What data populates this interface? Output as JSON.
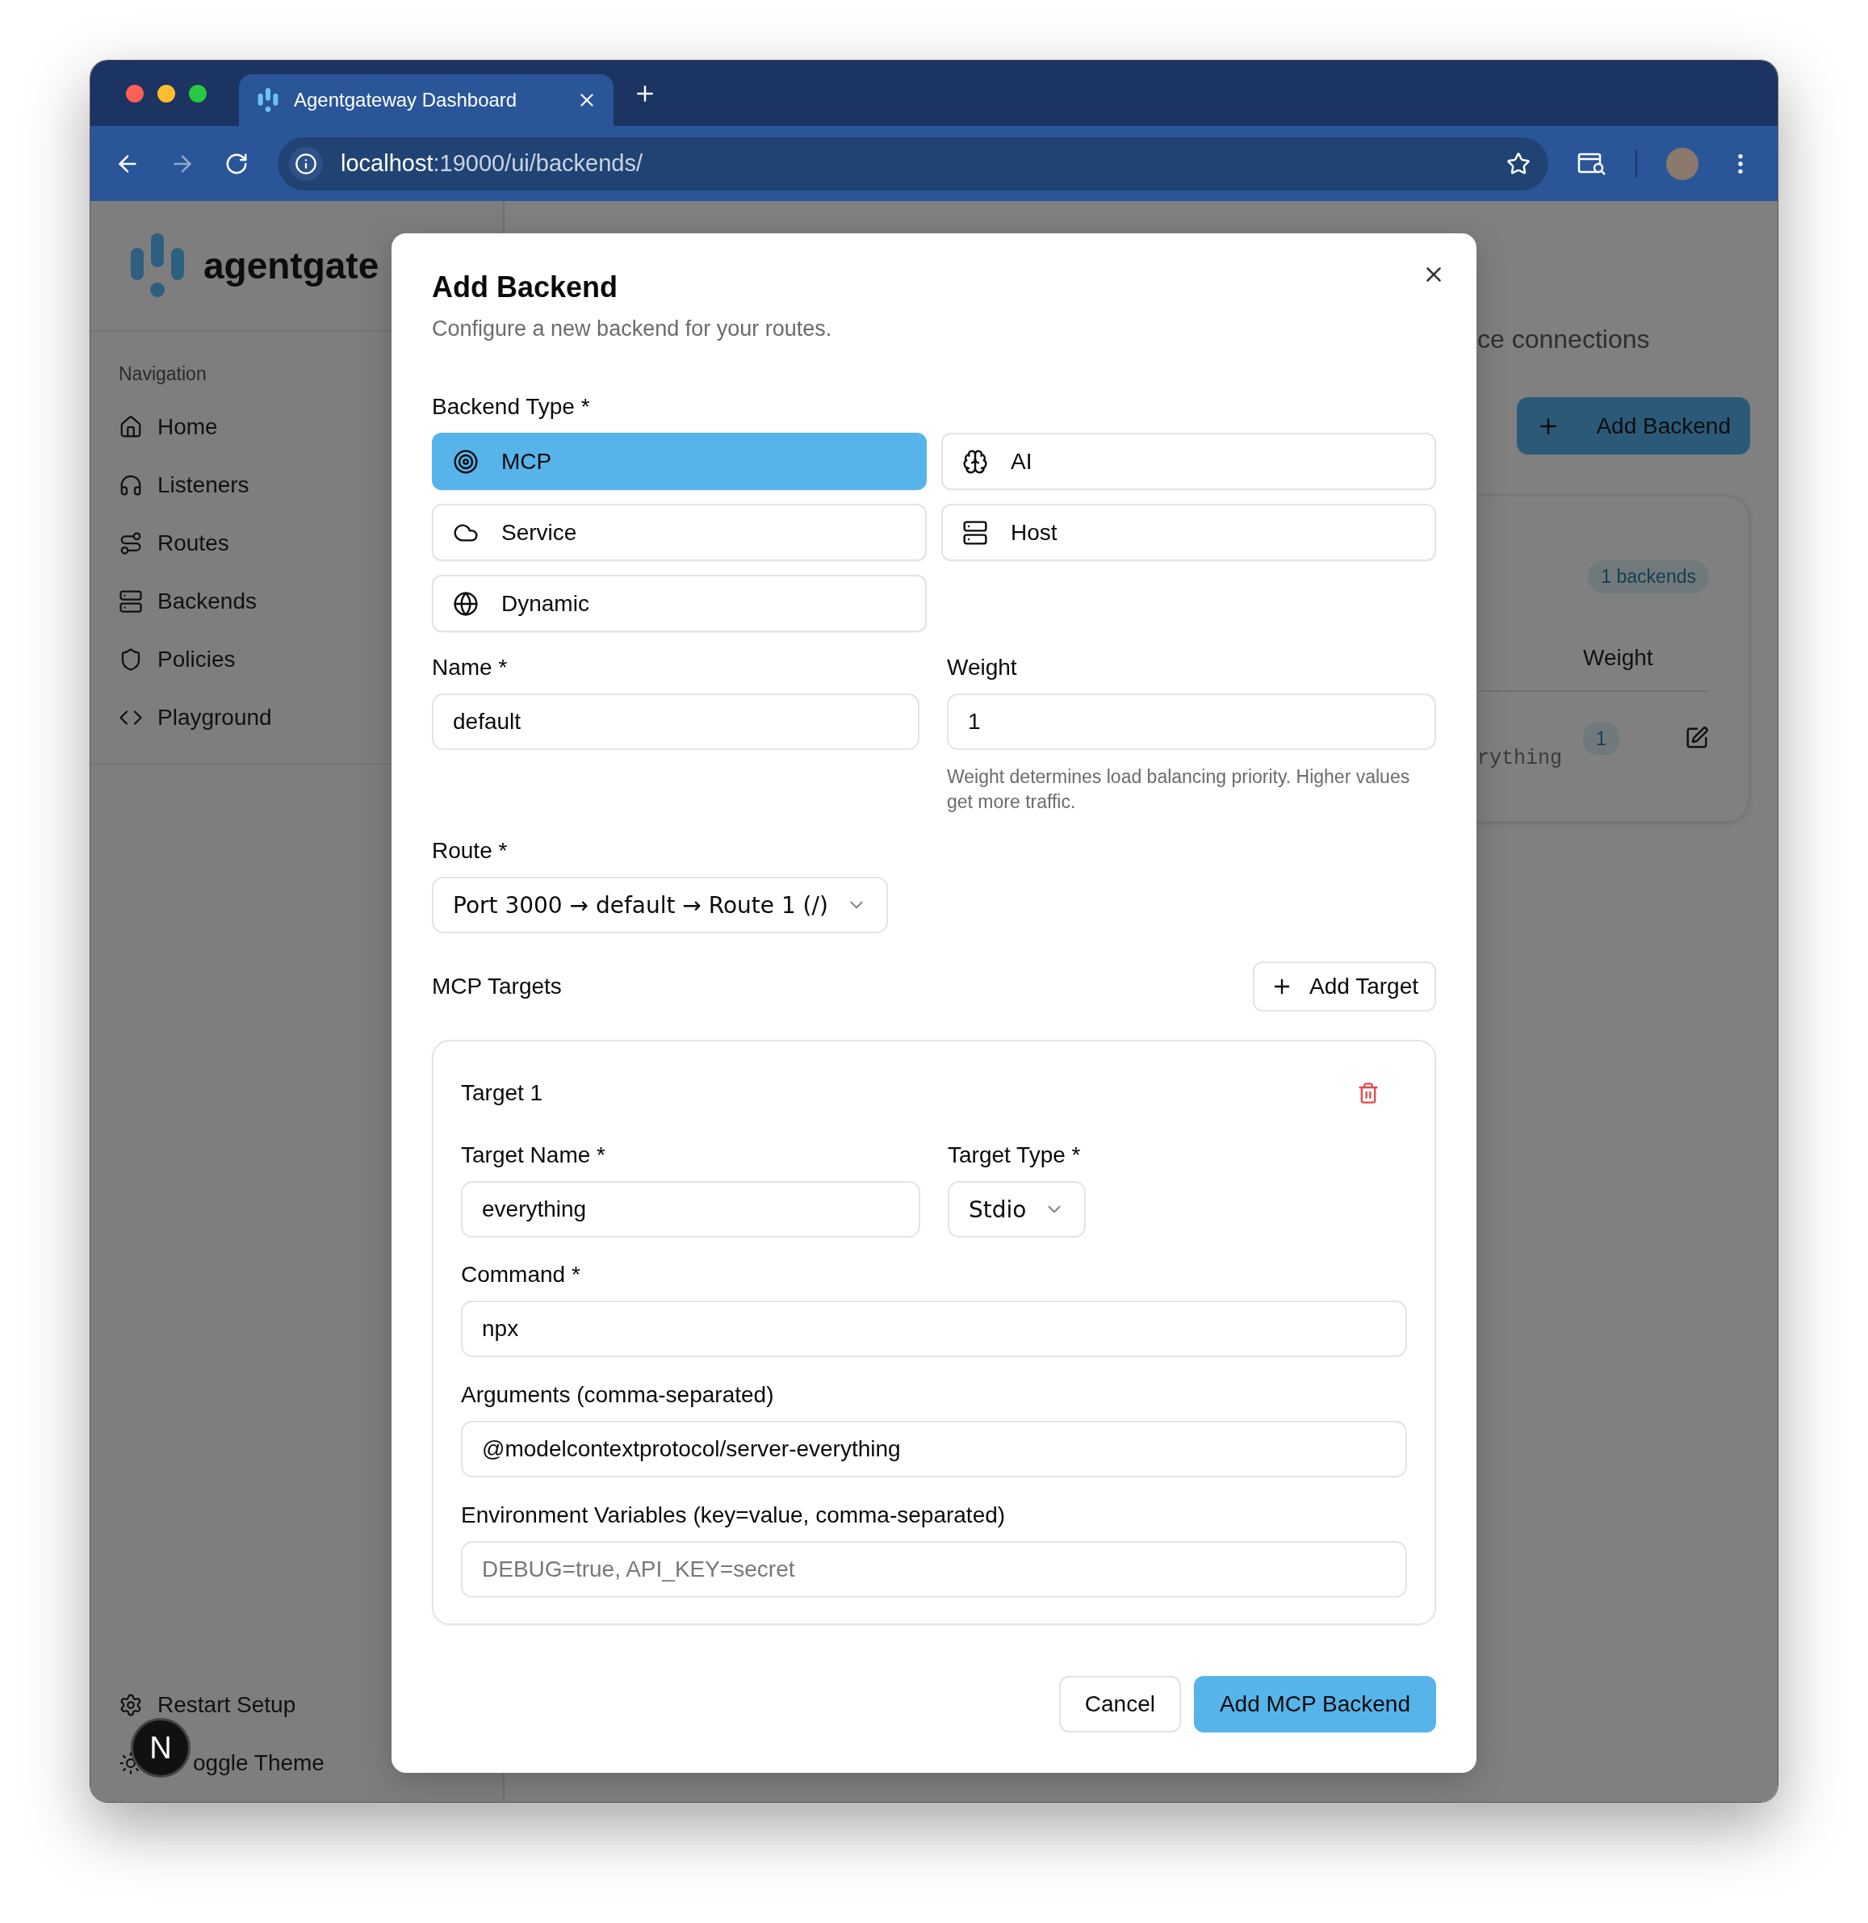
{
  "browser": {
    "tab_title": "Agentgateway Dashboard",
    "url_host": "localhost",
    "url_path": ":19000/ui/backends/"
  },
  "sidebar": {
    "brand": "agentgate",
    "section_label": "Navigation",
    "items": [
      {
        "label": "Home"
      },
      {
        "label": "Listeners"
      },
      {
        "label": "Routes"
      },
      {
        "label": "Backends"
      },
      {
        "label": "Policies"
      },
      {
        "label": "Playground"
      }
    ],
    "footer_items": [
      {
        "label": "Restart Setup"
      },
      {
        "label": "oggle Theme"
      }
    ]
  },
  "page": {
    "subtitle_fragment": "ce connections",
    "add_button": "Add Backend",
    "count_badge": "1 backends",
    "column_header": "Weight",
    "row": {
      "cell_fragment": "rything",
      "weight": "1"
    }
  },
  "dialog": {
    "title": "Add Backend",
    "description": "Configure a new backend for your routes.",
    "backend_type": {
      "label": "Backend Type *",
      "options": [
        {
          "label": "MCP",
          "selected": true
        },
        {
          "label": "AI",
          "selected": false
        },
        {
          "label": "Service",
          "selected": false
        },
        {
          "label": "Host",
          "selected": false
        },
        {
          "label": "Dynamic",
          "selected": false
        }
      ]
    },
    "name": {
      "label": "Name *",
      "value": "default"
    },
    "weight": {
      "label": "Weight",
      "value": "1",
      "help": "Weight determines load balancing priority. Higher values get more traffic."
    },
    "route": {
      "label": "Route *",
      "value": "Port 3000 → default → Route 1 (/)"
    },
    "targets": {
      "label": "MCP Targets",
      "add_button": "Add Target",
      "items": [
        {
          "title": "Target 1",
          "name": {
            "label": "Target Name *",
            "value": "everything"
          },
          "type": {
            "label": "Target Type *",
            "value": "Stdio"
          },
          "command": {
            "label": "Command *",
            "value": "npx"
          },
          "arguments": {
            "label": "Arguments (comma-separated)",
            "value": "@modelcontextprotocol/server-everything"
          },
          "env": {
            "label": "Environment Variables (key=value, comma-separated)",
            "placeholder": "DEBUG=true, API_KEY=secret"
          }
        }
      ]
    },
    "buttons": {
      "cancel": "Cancel",
      "submit": "Add MCP Backend"
    }
  },
  "dev_badge": "N"
}
